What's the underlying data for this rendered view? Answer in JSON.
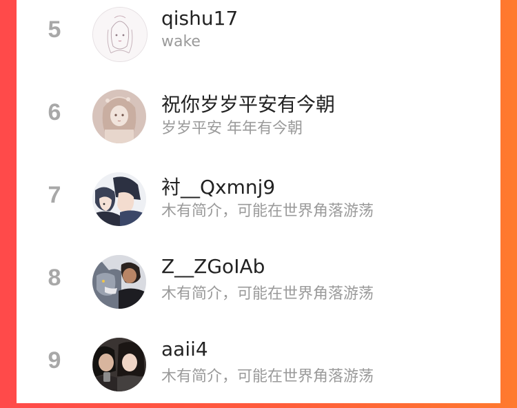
{
  "rows": [
    {
      "rank": "5",
      "name": "qishu17",
      "bio": "wake",
      "avatar": "line-drawing-girl-avatar"
    },
    {
      "rank": "6",
      "name": "祝你岁岁平安有今朝",
      "bio": "岁岁平安 年年有今朝",
      "avatar": "sepia-girl-avatar"
    },
    {
      "rank": "7",
      "name": "衬__Qxmnj9",
      "bio": "木有简介，可能在世界角落游荡",
      "avatar": "anime-couple-avatar"
    },
    {
      "rank": "8",
      "name": "Z__ZGoIAb",
      "bio": "木有简介，可能在世界角落游荡",
      "avatar": "wolf-man-avatar"
    },
    {
      "rank": "9",
      "name": "aaii4",
      "bio": "木有简介，可能在世界角落游荡",
      "avatar": "photo-couple-avatar"
    }
  ],
  "colors": {
    "background_gradient_start": "#ff4a4a",
    "background_gradient_end": "#ff7a2e",
    "rank_color": "#a8a8a8",
    "name_color": "#222222",
    "bio_color": "#9a9a9a"
  }
}
